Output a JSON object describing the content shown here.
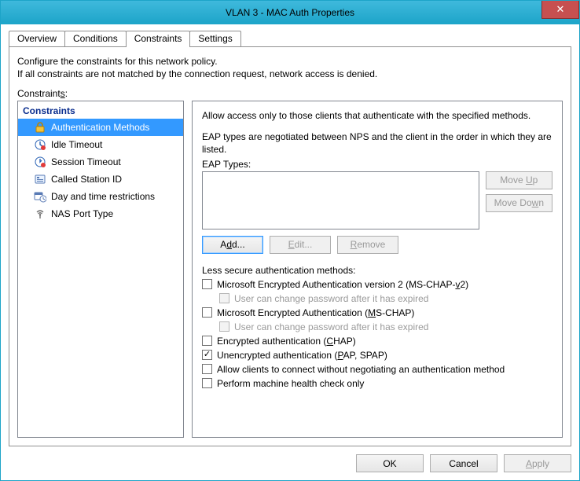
{
  "window": {
    "title": "VLAN 3 - MAC Auth Properties"
  },
  "tabs": {
    "overview": "Overview",
    "conditions": "Conditions",
    "constraints": "Constraints",
    "settings": "Settings",
    "active": "constraints"
  },
  "intro": {
    "line1": "Configure the constraints for this network policy.",
    "line2": "If all constraints are not matched by the connection request, network access is denied."
  },
  "constraints_label": "Constraints:",
  "tree": {
    "header": "Constraints",
    "items": [
      {
        "label": "Authentication Methods",
        "icon": "lock",
        "selected": true
      },
      {
        "label": "Idle Timeout",
        "icon": "idle",
        "selected": false
      },
      {
        "label": "Session Timeout",
        "icon": "session",
        "selected": false
      },
      {
        "label": "Called Station ID",
        "icon": "station",
        "selected": false
      },
      {
        "label": "Day and time restrictions",
        "icon": "calendar",
        "selected": false
      },
      {
        "label": "NAS Port Type",
        "icon": "nas",
        "selected": false
      }
    ]
  },
  "right": {
    "desc1": "Allow access only to those clients that authenticate with the specified methods.",
    "desc2": "EAP types are negotiated between NPS and the client in the order in which they are listed.",
    "eap_label": "EAP Types:",
    "btn_moveup": "Move Up",
    "btn_movedown": "Move Down",
    "btn_add": "Add...",
    "btn_edit": "Edit...",
    "btn_remove": "Remove",
    "less_secure_label": "Less secure authentication methods:",
    "cb_mschapv2": "Microsoft Encrypted Authentication version 2 (MS-CHAP-v2)",
    "cb_mschapv2_sub": "User can change password after it has expired",
    "cb_mschap": "Microsoft Encrypted Authentication (MS-CHAP)",
    "cb_mschap_sub": "User can change password after it has expired",
    "cb_chap": "Encrypted authentication (CHAP)",
    "cb_pap": "Unencrypted authentication (PAP, SPAP)",
    "cb_noneg": "Allow clients to connect without negotiating an authentication method",
    "cb_health": "Perform machine health check only",
    "checked": {
      "mschapv2": false,
      "mschap": false,
      "chap": false,
      "pap": true,
      "noneg": false,
      "health": false
    }
  },
  "dlg": {
    "ok": "OK",
    "cancel": "Cancel",
    "apply": "Apply"
  }
}
